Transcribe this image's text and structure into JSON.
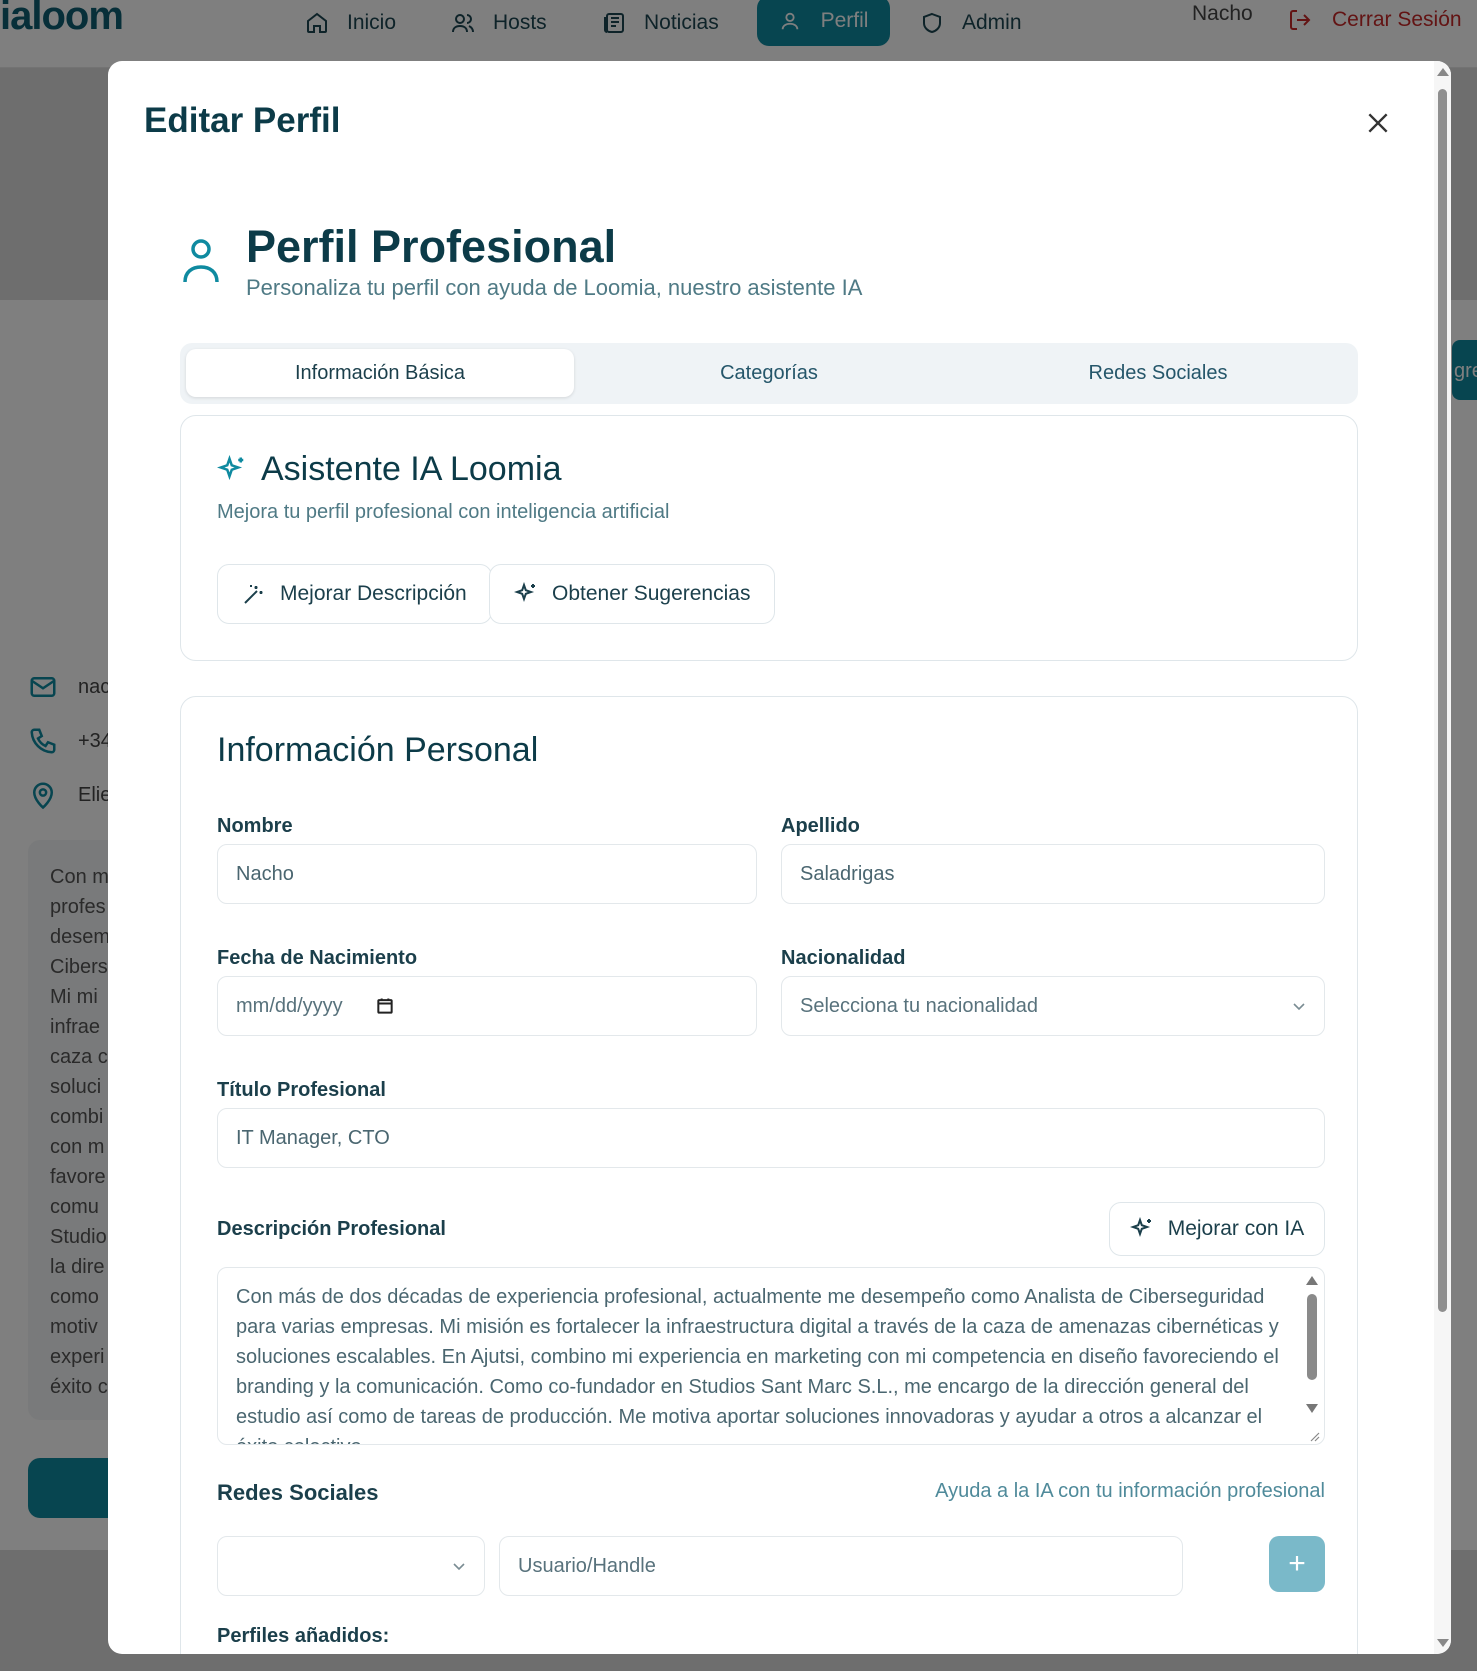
{
  "nav": {
    "logo": "ialoom",
    "items": [
      {
        "label": "Inicio",
        "icon": "home-icon"
      },
      {
        "label": "Hosts",
        "icon": "users-icon"
      },
      {
        "label": "Noticias",
        "icon": "newspaper-icon"
      },
      {
        "label": "Perfil",
        "icon": "user-icon"
      },
      {
        "label": "Admin",
        "icon": "shield-icon"
      }
    ],
    "user": "Nacho",
    "logout": "Cerrar Sesión"
  },
  "background": {
    "contacts": [
      "nac",
      "+34",
      "Elie"
    ],
    "description_fragment": "Con m\nprofes\ndesem\nCibers\nMi mi\ninfrae\ncaza c\nsoluci\ncombi\ncon m\nfavore\ncomu\nStudio\nla dire\ncomo\nmotiv\nexperi\néxito c",
    "right_button_fragment": "gre"
  },
  "modal": {
    "title": "Editar Perfil",
    "header": {
      "title": "Perfil Profesional",
      "subtitle": "Personaliza tu perfil con ayuda de Loomia, nuestro asistente IA"
    },
    "tabs": [
      {
        "label": "Información Básica",
        "active": true
      },
      {
        "label": "Categorías",
        "active": false
      },
      {
        "label": "Redes Sociales",
        "active": false
      }
    ],
    "assistant": {
      "title": "Asistente IA Loomia",
      "subtitle": "Mejora tu perfil profesional con inteligencia artificial",
      "improve_button": "Mejorar Descripción",
      "suggest_button": "Obtener Sugerencias"
    },
    "personal": {
      "title": "Información Personal",
      "nombre_label": "Nombre",
      "nombre_value": "Nacho",
      "apellido_label": "Apellido",
      "apellido_value": "Saladrigas",
      "fecha_label": "Fecha de Nacimiento",
      "fecha_placeholder": "mm/dd/yyyy",
      "nacionalidad_label": "Nacionalidad",
      "nacionalidad_placeholder": "Selecciona tu nacionalidad",
      "titulo_label": "Título Profesional",
      "titulo_value": "IT Manager, CTO",
      "descripcion_label": "Descripción Profesional",
      "mejorar_ia_button": "Mejorar con IA",
      "descripcion_value": "Con más de dos décadas de experiencia profesional, actualmente me desempeño como Analista de Ciberseguridad para varias empresas. Mi misión es fortalecer la infraestructura digital a través de la caza de amenazas cibernéticas y soluciones escalables. En Ajutsi, combino mi experiencia en marketing con mi competencia en diseño favoreciendo el branding y la comunicación. Como co-fundador en Studios Sant Marc S.L., me encargo de la dirección general del estudio así como de tareas de producción. Me motiva aportar soluciones innovadoras y ayudar a otros a alcanzar el éxito colectivo.",
      "redes_label": "Redes Sociales",
      "redes_help": "Ayuda a la IA con tu información profesional",
      "handle_placeholder": "Usuario/Handle",
      "add_button": "+",
      "perfiles_label": "Perfiles añadidos:"
    }
  },
  "colors": {
    "accent": "#0f8aa0",
    "logout": "#c62828",
    "title": "#0c3b48"
  }
}
